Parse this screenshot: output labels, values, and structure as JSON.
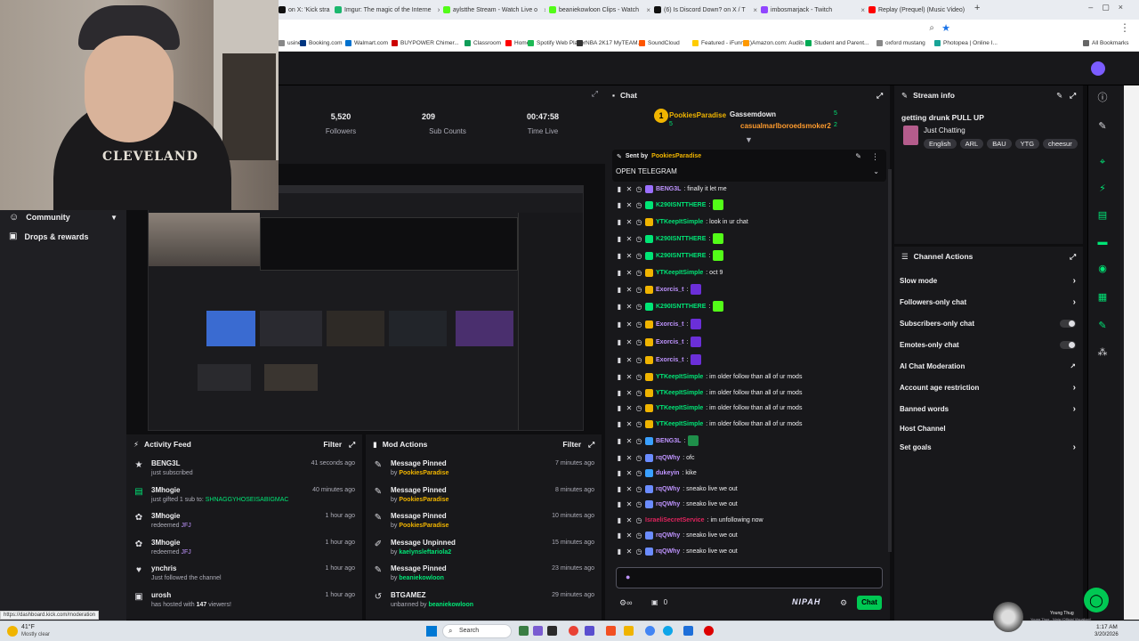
{
  "browser": {
    "tabs": [
      {
        "label": "on X: 'Kick stra",
        "color": "#111"
      },
      {
        "label": "Imgur: The magic of the Interne",
        "color": "#1bb76e"
      },
      {
        "label": "aylstthe Stream - Watch Live o",
        "color": "#53fc18"
      },
      {
        "label": "beaniekowloon Clips - Watch",
        "color": "#53fc18"
      },
      {
        "label": "(6) Is Discord Down? on X / T",
        "color": "#111"
      },
      {
        "label": "imbosmarjack - Twitch",
        "color": "#9146ff"
      },
      {
        "label": "Replay (Prequel) (Music Video)",
        "color": "#ff0000"
      }
    ],
    "bookmarks": [
      {
        "label": "usines",
        "color": "#888"
      },
      {
        "label": "Booking.com",
        "color": "#003580"
      },
      {
        "label": "Walmart.com",
        "color": "#0071ce"
      },
      {
        "label": "BUYPOWER Chimer...",
        "color": "#c00"
      },
      {
        "label": "Classroom",
        "color": "#0f9d58"
      },
      {
        "label": "Home",
        "color": "#f00"
      },
      {
        "label": "Spotify Web Player",
        "color": "#1db954"
      },
      {
        "label": "NBA 2K17 MyTEAM...",
        "color": "#333"
      },
      {
        "label": "SoundCloud",
        "color": "#f50"
      },
      {
        "label": "Featured - iFunny :)",
        "color": "#fc0"
      },
      {
        "label": "Amazon.com: Audib...",
        "color": "#f90"
      },
      {
        "label": "Student and Parent...",
        "color": "#0a5"
      },
      {
        "label": "oxford mustang",
        "color": "#888"
      },
      {
        "label": "Photopea | Online I...",
        "color": "#18a497"
      },
      {
        "label": "All Bookmarks",
        "color": "#666"
      }
    ]
  },
  "nav": {
    "community": "Community",
    "drops": "Drops & rewards"
  },
  "webcam": {
    "shirt_text": "CLEVELAND"
  },
  "stats": [
    {
      "value": "5,520",
      "label": "Followers"
    },
    {
      "value": "209",
      "label": "Sub Counts"
    },
    {
      "value": "00:47:58",
      "label": "Time Live"
    }
  ],
  "activity": {
    "title": "Activity Feed",
    "filter": "Filter",
    "items": [
      {
        "icon": "★",
        "name": "BENG3L",
        "detail": "just subscribed",
        "extra": "",
        "time": "41 seconds ago"
      },
      {
        "icon": "▤",
        "name": "3Mhogie",
        "detail": "just gifted 1 sub to:",
        "extra": "SHNAGGYHOSEISABIGMAC",
        "time": "40 minutes ago"
      },
      {
        "icon": "✿",
        "name": "3Mhogie",
        "detail": "redeemed",
        "extra": "JFJ",
        "time": "1 hour ago"
      },
      {
        "icon": "✿",
        "name": "3Mhogie",
        "detail": "redeemed",
        "extra": "JFJ",
        "time": "1 hour ago"
      },
      {
        "icon": "♥",
        "name": "ynchris",
        "detail": "Just followed the channel",
        "extra": "",
        "time": "1 hour ago"
      },
      {
        "icon": "▣",
        "name": "urosh",
        "detail": "has hosted with",
        "extra": "147",
        "extra2": "viewers!",
        "time": "1 hour ago"
      }
    ]
  },
  "mod": {
    "title": "Mod Actions",
    "filter": "Filter",
    "items": [
      {
        "icon": "✎",
        "title": "Message Pinned",
        "by": "by",
        "who": "PookiesParadise",
        "time": "7 minutes ago"
      },
      {
        "icon": "✎",
        "title": "Message Pinned",
        "by": "by",
        "who": "PookiesParadise",
        "time": "8 minutes ago"
      },
      {
        "icon": "✎",
        "title": "Message Pinned",
        "by": "by",
        "who": "PookiesParadise",
        "time": "10 minutes ago"
      },
      {
        "icon": "✐",
        "title": "Message Unpinned",
        "by": "by",
        "who": "kaelynsleftariola2",
        "time": "15 minutes ago"
      },
      {
        "icon": "✎",
        "title": "Message Pinned",
        "by": "by",
        "who": "beaniekowloon",
        "time": "23 minutes ago"
      },
      {
        "icon": "↺",
        "title": "BTGAMEZ",
        "by": "unbanned by",
        "who": "beaniekowloon",
        "time": "29 minutes ago"
      }
    ]
  },
  "chat": {
    "title": "Chat",
    "top_gifters": [
      {
        "name": "PookiesParadise",
        "count": "5"
      },
      {
        "name": "Gassemdown",
        "count": "5"
      },
      {
        "name": "casualmarlboroedsmoker2",
        "count": "2"
      }
    ],
    "pinned_label": "Sent by",
    "pinned_by": "PookiesParadise",
    "pinned_text": "OPEN TELEGRAM",
    "messages": [
      {
        "name": "BENG3L",
        "color": "#bf94ff",
        "msg": ": finally it let me",
        "emote": "",
        "badge": "#9b6fff"
      },
      {
        "name": "K290ISNTTHERE",
        "color": "#00e676",
        "msg": ":",
        "emote": "#53fc18",
        "badge": "#00e676"
      },
      {
        "name": "YTKeepItSimple",
        "color": "#00e676",
        "msg": ": look in ur chat",
        "emote": "",
        "badge": "#f0b400"
      },
      {
        "name": "K290ISNTTHERE",
        "color": "#00e676",
        "msg": ":",
        "emote": "#53fc18",
        "badge": "#00e676"
      },
      {
        "name": "K290ISNTTHERE",
        "color": "#00e676",
        "msg": ":",
        "emote": "#53fc18",
        "badge": "#00e676"
      },
      {
        "name": "YTKeepItSimple",
        "color": "#00e676",
        "msg": ": oct 9",
        "emote": "",
        "badge": "#f0b400"
      },
      {
        "name": "Exorcis_t",
        "color": "#bf94ff",
        "msg": ":",
        "emote": "#6b2fd8",
        "badge": "#f0b400"
      },
      {
        "name": "K290ISNTTHERE",
        "color": "#00e676",
        "msg": ":",
        "emote": "#53fc18",
        "badge": "#00e676"
      },
      {
        "name": "Exorcis_t",
        "color": "#bf94ff",
        "msg": ":",
        "emote": "#6b2fd8",
        "badge": "#f0b400"
      },
      {
        "name": "Exorcis_t",
        "color": "#bf94ff",
        "msg": ":",
        "emote": "#6b2fd8",
        "badge": "#f0b400"
      },
      {
        "name": "Exorcis_t",
        "color": "#bf94ff",
        "msg": ":",
        "emote": "#6b2fd8",
        "badge": "#f0b400"
      },
      {
        "name": "YTKeepItSimple",
        "color": "#00e676",
        "msg": ": im older follow than all of ur mods",
        "emote": "",
        "badge": "#f0b400"
      },
      {
        "name": "YTKeepItSimple",
        "color": "#00e676",
        "msg": ": im older follow than all of ur mods",
        "emote": "",
        "badge": "#f0b400"
      },
      {
        "name": "YTKeepItSimple",
        "color": "#00e676",
        "msg": ": im older follow than all of ur mods",
        "emote": "",
        "badge": "#f0b400"
      },
      {
        "name": "YTKeepItSimple",
        "color": "#00e676",
        "msg": ": im older follow than all of ur mods",
        "emote": "",
        "badge": "#f0b400"
      },
      {
        "name": "BENG3L",
        "color": "#bf94ff",
        "msg": ":",
        "emote": "#1f8f4a",
        "badge": "#3aa0ff"
      },
      {
        "name": "rqQWhy",
        "color": "#bf94ff",
        "msg": ": ofc",
        "emote": "",
        "badge": "#6b8cff"
      },
      {
        "name": "dukeyin",
        "color": "#bf94ff",
        "msg": ": kike",
        "emote": "",
        "badge": "#3aa0ff"
      },
      {
        "name": "rqQWhy",
        "color": "#bf94ff",
        "msg": ": sneako live we out",
        "emote": "",
        "badge": "#6b8cff"
      },
      {
        "name": "rqQWhy",
        "color": "#bf94ff",
        "msg": ": sneako live we out",
        "emote": "",
        "badge": "#6b8cff"
      },
      {
        "name": "IsraeliSecretService",
        "color": "#e0245e",
        "msg": ": im unfollowing now",
        "emote": "",
        "badge": ""
      },
      {
        "name": "rqQWhy",
        "color": "#bf94ff",
        "msg": ": sneako live we out",
        "emote": "",
        "badge": "#6b8cff"
      },
      {
        "name": "rqQWhy",
        "color": "#bf94ff",
        "msg": ": sneako live we out",
        "emote": "",
        "badge": "#6b8cff"
      }
    ],
    "points": "0",
    "chat_button": "Chat",
    "nipah": "NIPAH"
  },
  "stream_info": {
    "title": "Stream info",
    "stream_title": "getting drunk PULL UP",
    "category": "Just Chatting",
    "tags": [
      "English",
      "ARL",
      "BAU",
      "YTG",
      "cheesur"
    ]
  },
  "channel_actions": {
    "title": "Channel Actions",
    "items": [
      {
        "label": "Slow mode",
        "ctl": "arrow"
      },
      {
        "label": "Followers-only chat",
        "ctl": "arrow"
      },
      {
        "label": "Subscribers-only chat",
        "ctl": "toggle"
      },
      {
        "label": "Emotes-only chat",
        "ctl": "toggle"
      },
      {
        "label": "AI Chat Moderation",
        "ctl": "ext"
      },
      {
        "label": "Account age restriction",
        "ctl": "arrow"
      },
      {
        "label": "Banned words",
        "ctl": "arrow"
      },
      {
        "label": "Host Channel",
        "ctl": "none"
      },
      {
        "label": "Set goals",
        "ctl": "arrow"
      }
    ]
  },
  "taskbar": {
    "weather": "41°F",
    "weather_sub": "Mostly clear",
    "search": "Search",
    "time": "1:17 AM",
    "date": "3/20/2026",
    "media_title": "Young Thug",
    "media_sub": "Young Thug - Ninja (Official Visualizer)",
    "url_status": "https://dashboard.kick.com/moderation"
  }
}
